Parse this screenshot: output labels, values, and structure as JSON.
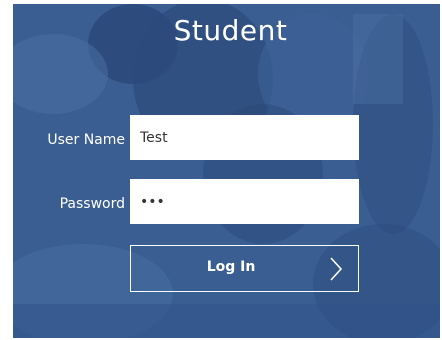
{
  "login": {
    "title": "Student",
    "username_label": "User Name",
    "username_value": "Test",
    "password_label": "Password",
    "password_value": "•••",
    "submit_label": "Log In",
    "submit_icon": "chevron-right-icon"
  },
  "colors": {
    "panel_background": "#3b5f93",
    "text": "#ffffff",
    "field_background": "#ffffff",
    "field_text": "#333333"
  }
}
